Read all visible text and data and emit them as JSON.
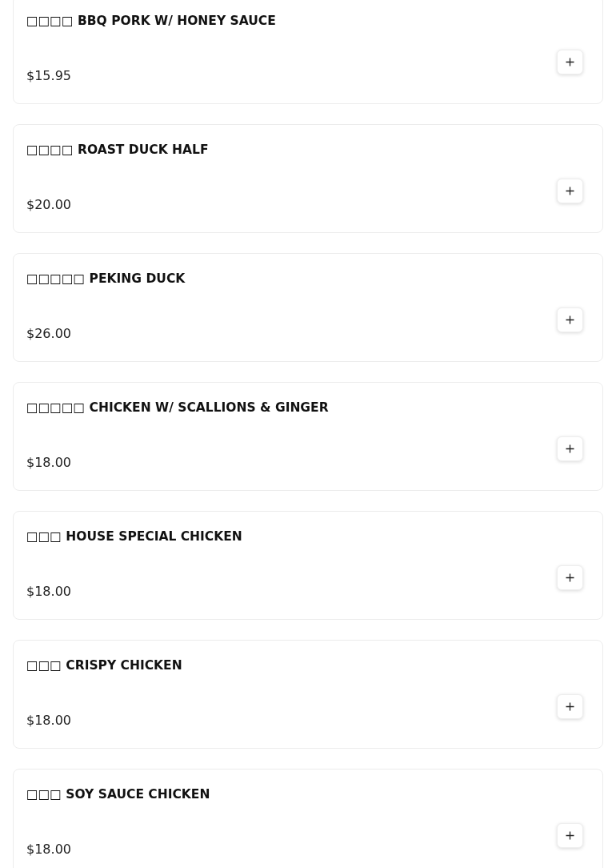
{
  "menu_items": [
    {
      "name": "□□□□ BBQ PORK W/ HONEY SAUCE",
      "price": "$15.95"
    },
    {
      "name": "□□□□ ROAST DUCK HALF",
      "price": "$20.00"
    },
    {
      "name": "□□□□□ PEKING DUCK",
      "price": "$26.00"
    },
    {
      "name": "□□□□□ CHICKEN W/ SCALLIONS & GINGER",
      "price": "$18.00"
    },
    {
      "name": "□□□ HOUSE SPECIAL CHICKEN",
      "price": "$18.00"
    },
    {
      "name": "□□□ CRISPY CHICKEN",
      "price": "$18.00"
    },
    {
      "name": "□□□ SOY SAUCE CHICKEN",
      "price": "$18.00"
    }
  ]
}
